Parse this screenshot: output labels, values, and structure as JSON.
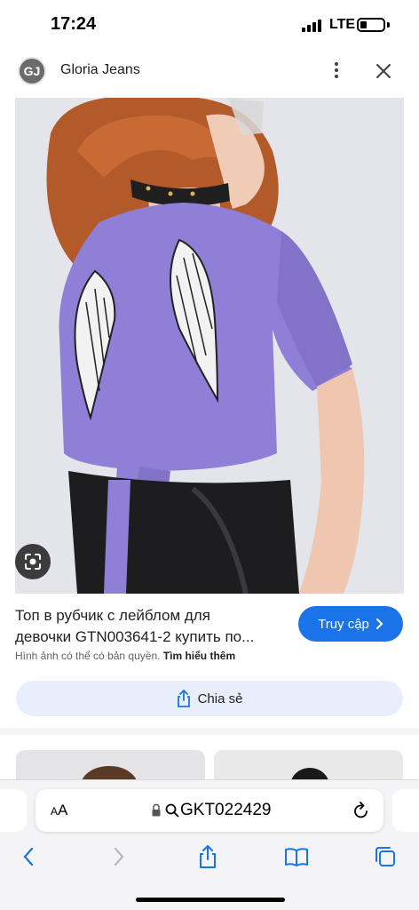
{
  "status_bar": {
    "time": "17:24",
    "network": "LTE"
  },
  "header": {
    "logo_text": "GJ",
    "site_name": "Gloria Jeans"
  },
  "result": {
    "title_line1": "Топ в рубчик с лейблом для",
    "title_line2": "девочки GTN003641-2 купить по...",
    "visit_label": "Truy cập",
    "copyright_text": "Hình ảnh có thể có bản quyền.",
    "learn_more": "Tìm hiểu thêm",
    "share_label": "Chia sẻ"
  },
  "browser": {
    "text_size_small": "A",
    "text_size_large": "A",
    "url": "GKT022429"
  },
  "colors": {
    "accent": "#1a73e8",
    "share_bg": "#e8eefb",
    "shirt": "#8f7fd6"
  }
}
